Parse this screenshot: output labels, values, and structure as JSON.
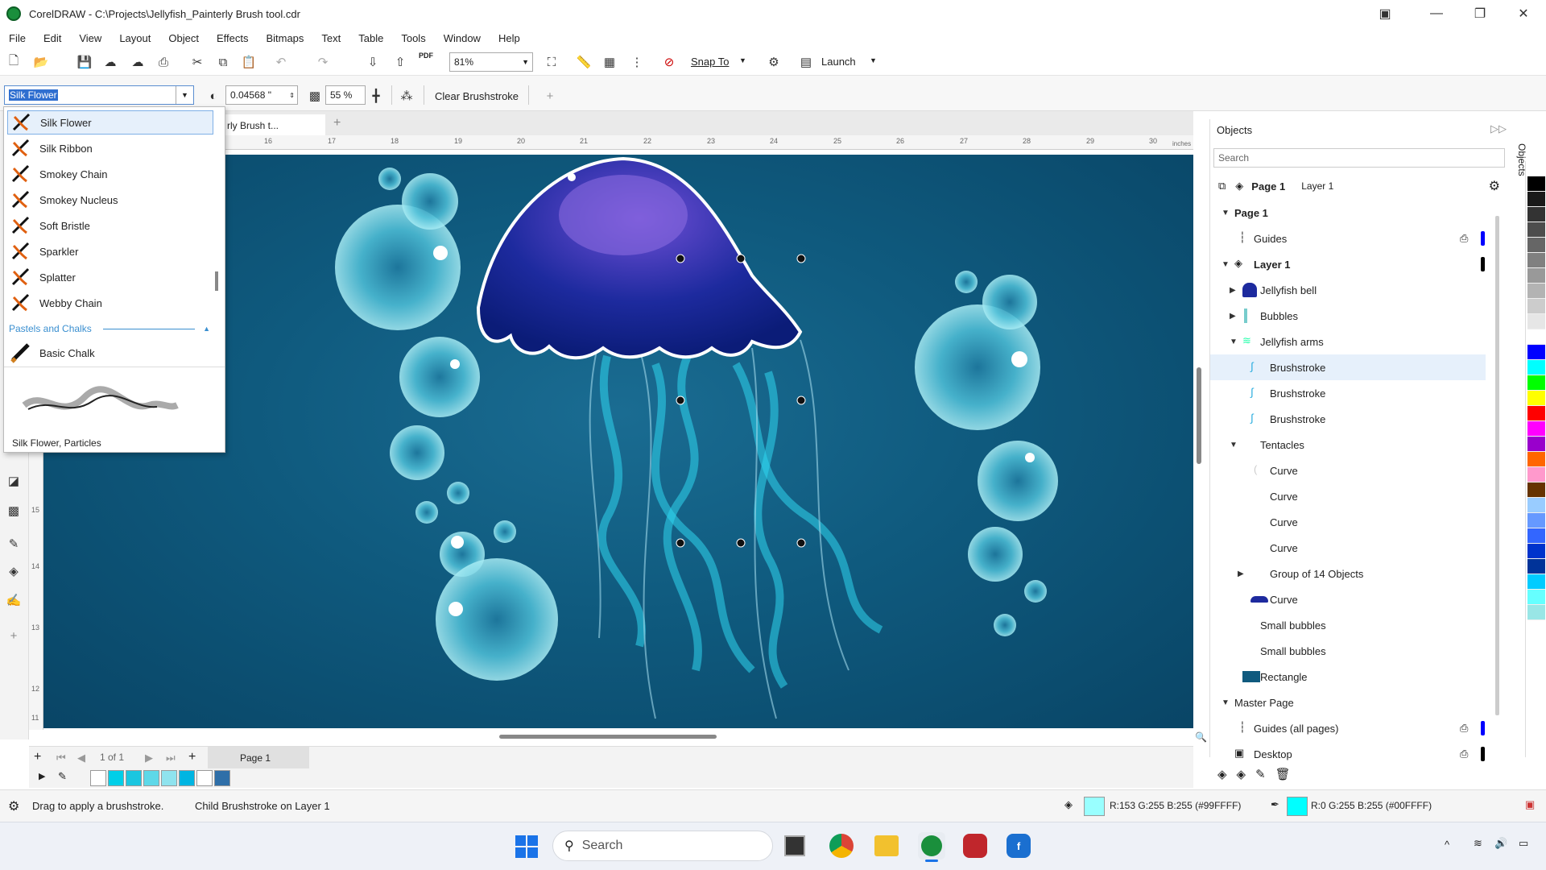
{
  "window": {
    "title": "CorelDRAW - C:\\Projects\\Jellyfish_Painterly Brush tool.cdr",
    "controls": [
      "minimize",
      "restore",
      "close"
    ]
  },
  "menu": [
    "File",
    "Edit",
    "View",
    "Layout",
    "Object",
    "Effects",
    "Bitmaps",
    "Text",
    "Table",
    "Tools",
    "Window",
    "Help"
  ],
  "toolbar": {
    "zoom": "81%",
    "snap_to": "Snap To",
    "launch": "Launch",
    "pdf": "PDF"
  },
  "property_bar": {
    "brush_name": "Silk Flower",
    "size": "0.04568 \"",
    "transparency": "55 %",
    "clear_label": "Clear Brushstroke"
  },
  "doc_tab": "rly Brush t...",
  "ruler": {
    "units": "inches",
    "h_ticks": [
      "16",
      "17",
      "18",
      "19",
      "20",
      "21",
      "22",
      "23",
      "24",
      "25",
      "26",
      "27",
      "28",
      "29",
      "30"
    ],
    "v_ticks": [
      "15",
      "14",
      "13",
      "12",
      "11"
    ]
  },
  "brush_dropdown": {
    "items": [
      "Silk Flower",
      "Silk Ribbon",
      "Smokey Chain",
      "Smokey Nucleus",
      "Soft Bristle",
      "Sparkler",
      "Splatter",
      "Webby Chain"
    ],
    "category": "Pastels and Chalks",
    "category_item": "Basic Chalk",
    "preview_caption": "Silk Flower, Particles"
  },
  "objects_panel": {
    "title": "Objects",
    "search_placeholder": "Search",
    "page_label": "Page 1",
    "layer_label": "Layer 1",
    "tree": [
      {
        "label": "Page 1",
        "bold": true
      },
      {
        "label": "Guides"
      },
      {
        "label": "Layer 1",
        "bold": true
      },
      {
        "label": "Jellyfish bell"
      },
      {
        "label": "Bubbles"
      },
      {
        "label": "Jellyfish arms"
      },
      {
        "label": "Brushstroke"
      },
      {
        "label": "Brushstroke"
      },
      {
        "label": "Brushstroke"
      },
      {
        "label": "Tentacles"
      },
      {
        "label": "Curve"
      },
      {
        "label": "Curve"
      },
      {
        "label": "Curve"
      },
      {
        "label": "Curve"
      },
      {
        "label": "Group of 14 Objects"
      },
      {
        "label": "Curve"
      },
      {
        "label": "Small bubbles"
      },
      {
        "label": "Small bubbles"
      },
      {
        "label": "Rectangle"
      },
      {
        "label": "Master Page"
      },
      {
        "label": "Guides (all pages)"
      },
      {
        "label": "Desktop"
      }
    ],
    "side_tab": "Objects"
  },
  "page_nav": {
    "counter": "1 of 1",
    "page_tab": "Page 1"
  },
  "status": {
    "hint": "Drag to apply a brushstroke.",
    "selection": "Child Brushstroke on Layer 1",
    "fill_value": "R:153 G:255 B:255 (#99FFFF)",
    "fill_color": "#99FFFF",
    "outline_value": "R:0 G:255 B:255 (#00FFFF)",
    "outline_color": "#00FFFF"
  },
  "doc_palette": [
    "#00CFE8",
    "#1BC6E0",
    "#5ED8E8",
    "#8FE3EE",
    "#00B5E2",
    "#FFFFFF",
    "#2F6FA8"
  ],
  "color_palette": [
    "#FFFFFF",
    "#000000",
    "#1a1a1a",
    "#333333",
    "#4d4d4d",
    "#666666",
    "#808080",
    "#999999",
    "#b3b3b3",
    "#cccccc",
    "#e6e6e6",
    "#ffffff",
    "#0000FF",
    "#00FFFF",
    "#00FF00",
    "#FFFF00",
    "#FF0000",
    "#FF00FF",
    "#9900CC",
    "#FF6600",
    "#FF99CC",
    "#663300",
    "#99CCFF",
    "#6699FF",
    "#3366FF",
    "#0033CC",
    "#003399",
    "#00CCFF",
    "#66FFFF",
    "#99E6E6"
  ],
  "taskbar": {
    "search_placeholder": "Search"
  },
  "canvas": {
    "background": "#0f5a7e"
  }
}
